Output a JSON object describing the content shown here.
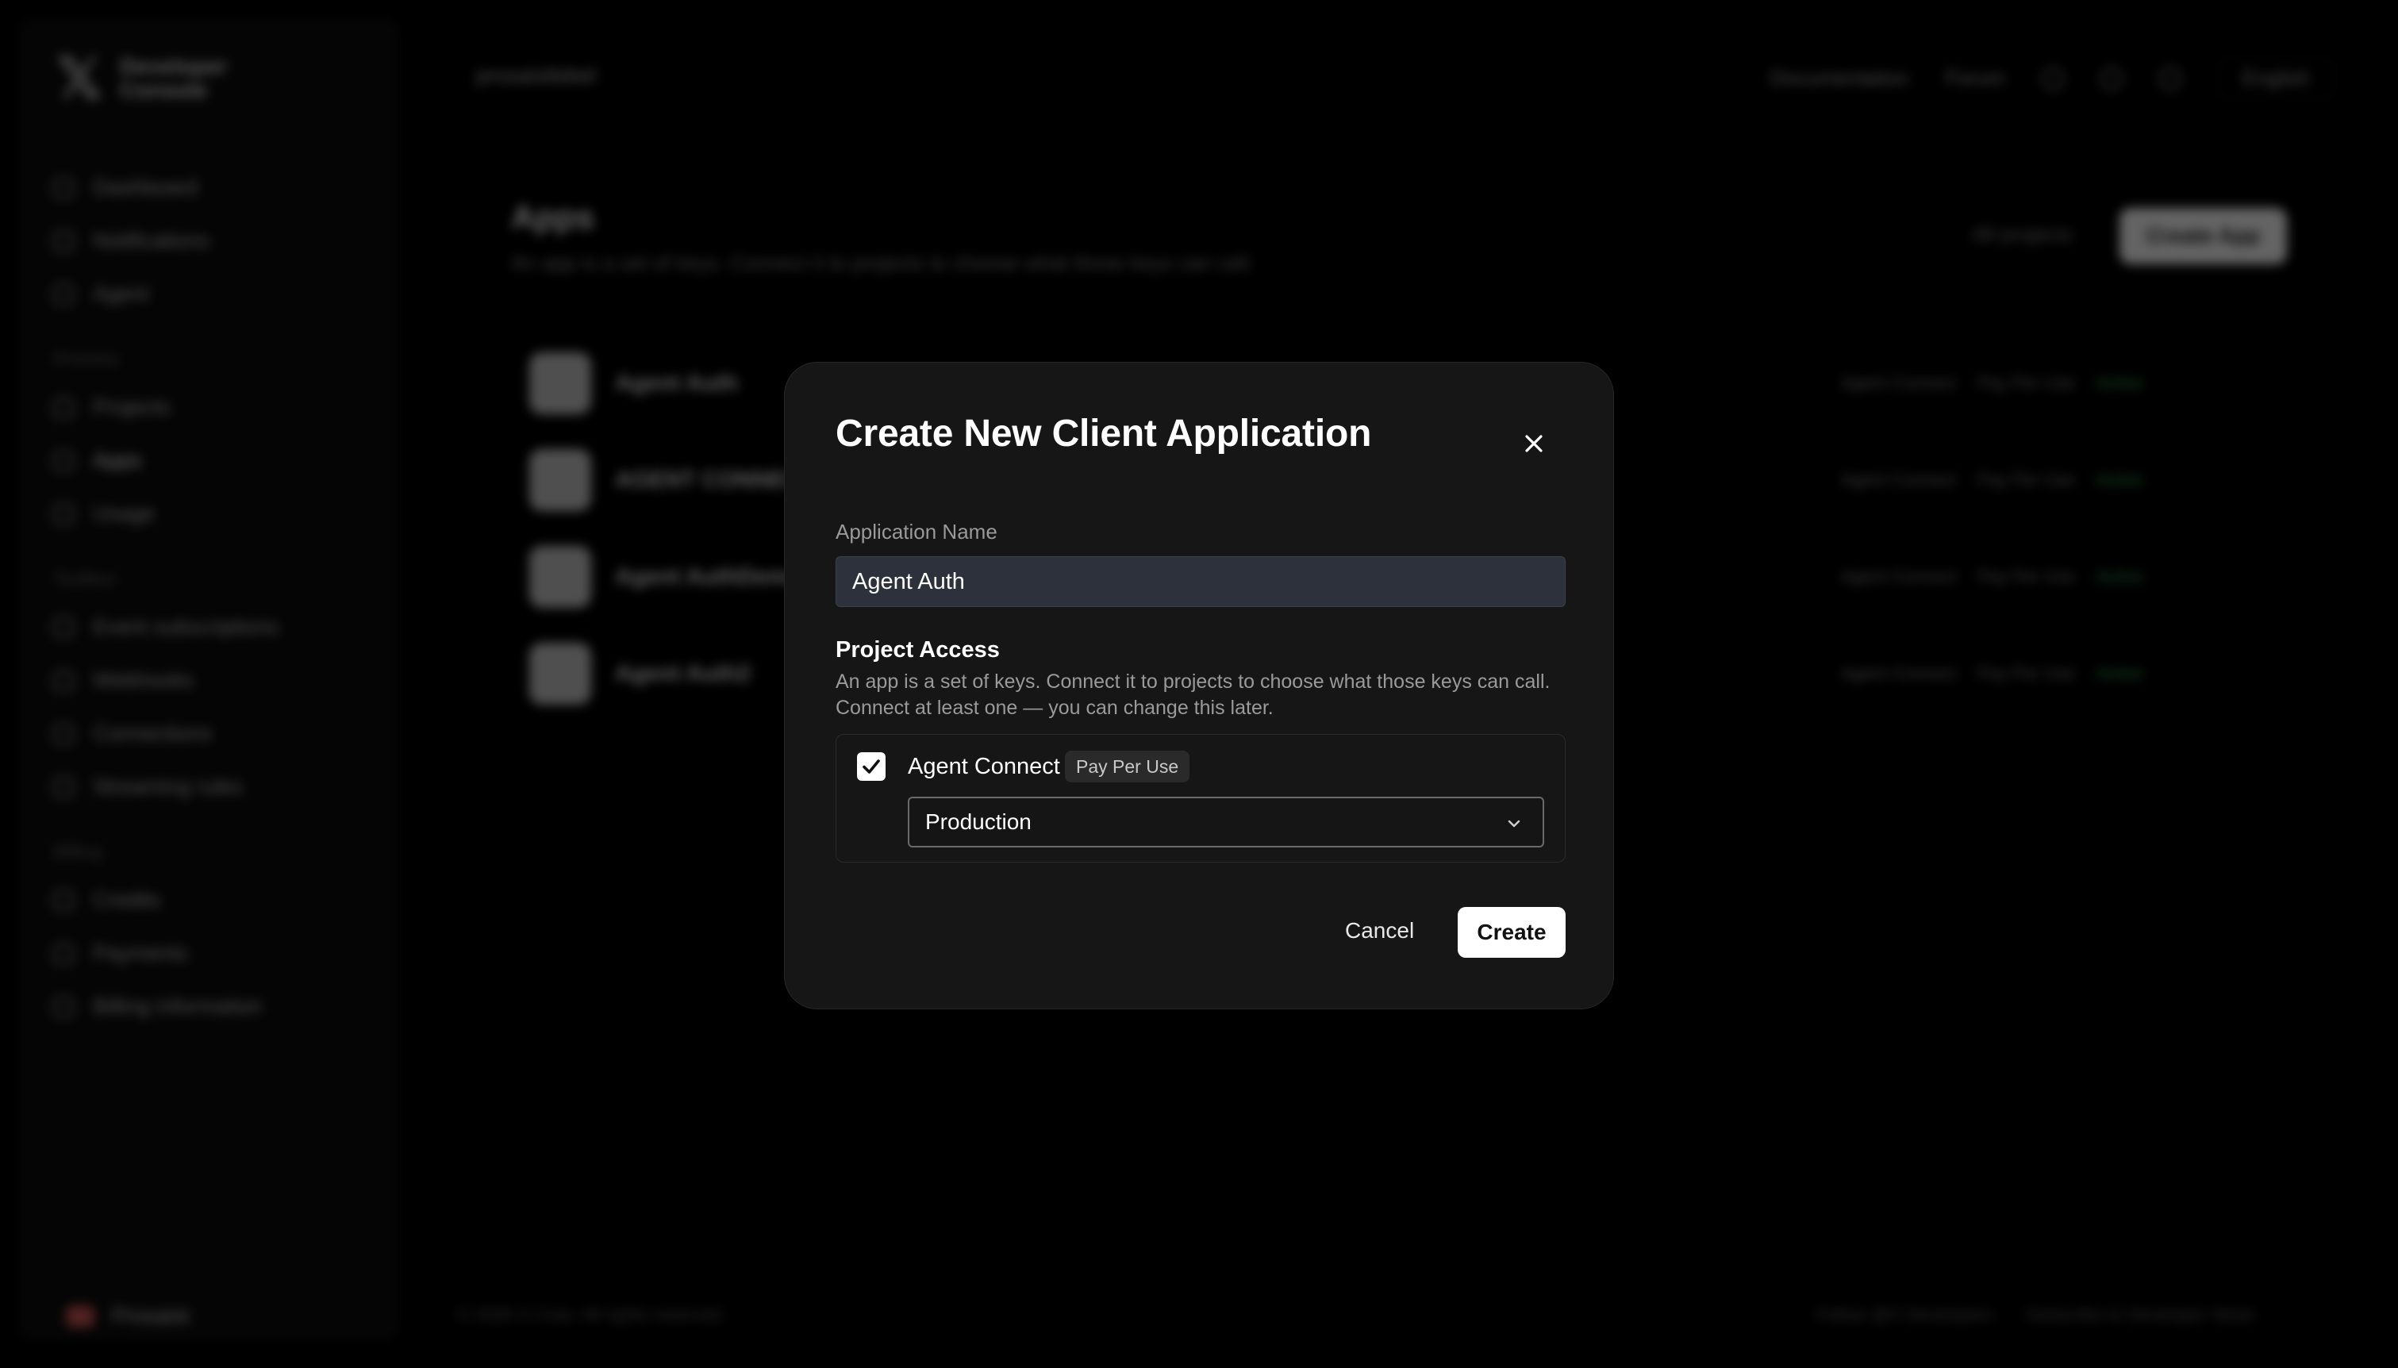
{
  "background": {
    "brand": {
      "logo": "𝕏",
      "line1": "Developer",
      "line2": "Console"
    },
    "nav": [
      {
        "label": "Dashboard"
      },
      {
        "label": "Notifications"
      },
      {
        "label": "Agent"
      }
    ],
    "sections": [
      {
        "title": "Process",
        "items": [
          {
            "label": "Projects"
          },
          {
            "label": "Apps",
            "active": true
          },
          {
            "label": "Usage"
          }
        ]
      },
      {
        "title": "Toolbox",
        "items": [
          {
            "label": "Event subscriptions"
          },
          {
            "label": "Webhooks"
          },
          {
            "label": "Connections"
          },
          {
            "label": "Streaming rules"
          }
        ]
      },
      {
        "title": "Billing",
        "items": [
          {
            "label": "Credits"
          },
          {
            "label": "Payments"
          },
          {
            "label": "Billing information"
          }
        ]
      }
    ],
    "profile": {
      "name": "Prosaist"
    },
    "topbar": {
      "crumb": "prosaistlabel",
      "documentation": "Documentation",
      "forum": "Forum",
      "language": "English"
    },
    "main": {
      "title": "Apps",
      "subtitle": "An app is a set of keys. Connect it to projects to choose what those keys can call.",
      "filter": "All projects",
      "create_app": "Create App",
      "apps": [
        {
          "name": "Agent Auth",
          "project": "Agent Connect",
          "plan": "Pay Per Use",
          "status": "Active"
        },
        {
          "name": "AGENT CONNECT",
          "project": "Agent Connect",
          "plan": "Pay Per Use",
          "status": "Active"
        },
        {
          "name": "Agent AuthDemo",
          "project": "Agent Connect",
          "plan": "Pay Per Use",
          "status": "Active"
        },
        {
          "name": "Agent Auth2",
          "project": "Agent Connect",
          "plan": "Pay Per Use",
          "status": "Active"
        }
      ]
    },
    "footer": {
      "copyright": "© 2026 X Corp. All rights reserved.",
      "follow": "Follow @X Developers",
      "subscribe": "Subscribe to Developer News"
    }
  },
  "modal": {
    "title": "Create New Client Application",
    "close_icon": "close-icon",
    "app_name_label": "Application Name",
    "app_name_value": "Agent Auth",
    "project_access_title": "Project Access",
    "project_access_desc_1": "An app is a set of keys. Connect it to projects to choose what those keys can call.",
    "project_access_desc_2": "Connect at least one — you can change this later.",
    "project": {
      "name": "Agent Connect",
      "plan_badge": "Pay Per Use",
      "checked": true,
      "environment": "Production"
    },
    "cancel_label": "Cancel",
    "create_label": "Create"
  }
}
